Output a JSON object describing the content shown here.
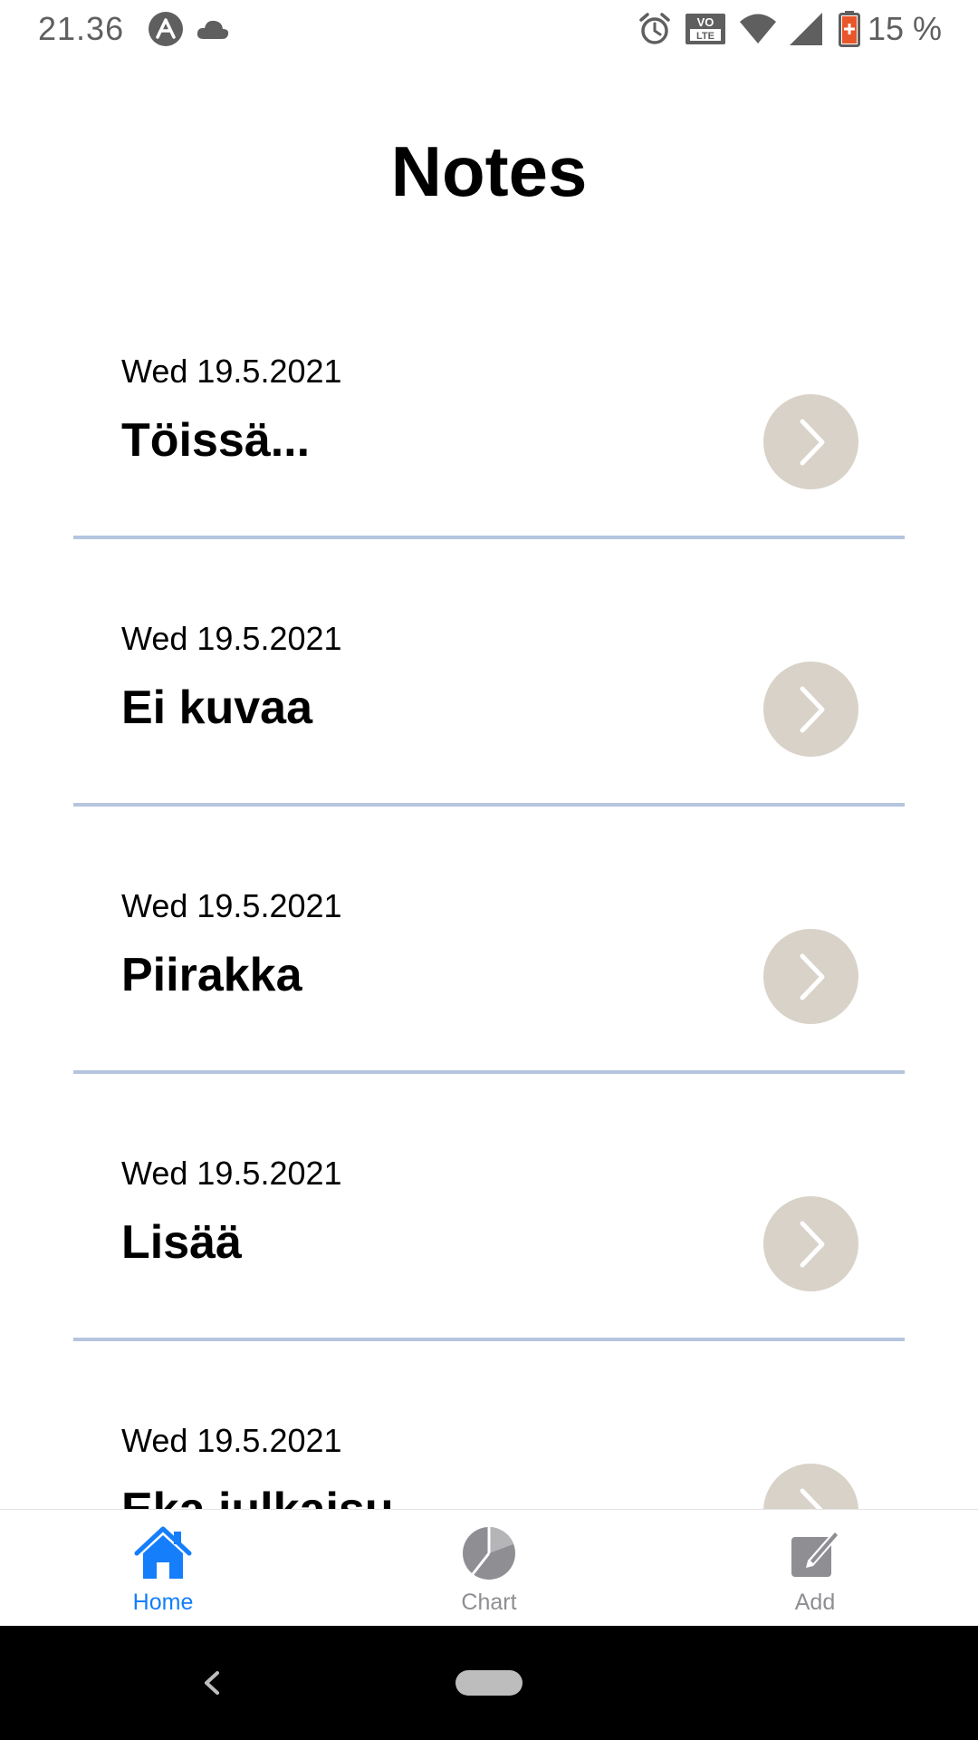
{
  "status_bar": {
    "time": "21.36",
    "battery_percent": "15 %",
    "icons": [
      "app-icon",
      "cloud-icon",
      "alarm-icon",
      "volte-icon",
      "wifi-icon",
      "signal-icon",
      "battery-icon"
    ]
  },
  "page": {
    "title": "Notes"
  },
  "notes": [
    {
      "date": "Wed 19.5.2021",
      "title": "Töissä..."
    },
    {
      "date": "Wed 19.5.2021",
      "title": "Ei kuvaa"
    },
    {
      "date": "Wed 19.5.2021",
      "title": "Piirakka"
    },
    {
      "date": "Wed 19.5.2021",
      "title": "Lisää"
    },
    {
      "date": "Wed 19.5.2021",
      "title": "Eka julkaisu"
    }
  ],
  "tabs": [
    {
      "label": "Home",
      "icon": "home-icon",
      "active": true
    },
    {
      "label": "Chart",
      "icon": "pie-chart-icon",
      "active": false
    },
    {
      "label": "Add",
      "icon": "edit-icon",
      "active": false
    }
  ],
  "colors": {
    "accent": "#147efb",
    "arrow_bg": "#d8d2c8",
    "divider": "#b5c5dd",
    "inactive": "#8e8e93"
  }
}
